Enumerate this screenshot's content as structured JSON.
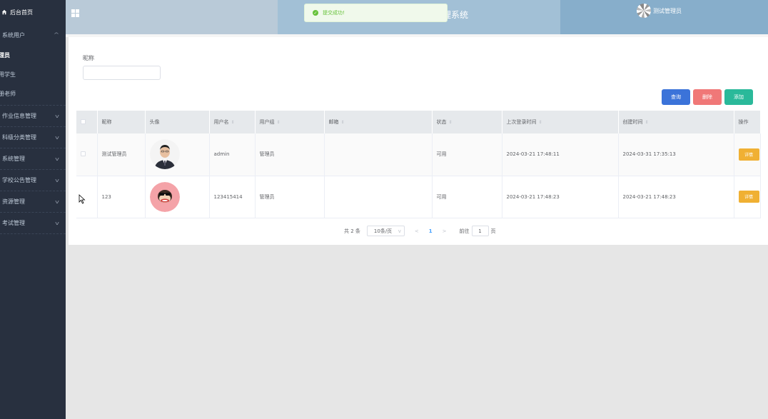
{
  "sidebar": {
    "home_label": "后台首页",
    "groups": [
      {
        "label": "系统用户",
        "expanded": true,
        "items": [
          {
            "label": "理员",
            "active": true
          },
          {
            "label": "用学生",
            "active": false
          },
          {
            "label": "册老师",
            "active": false
          }
        ]
      },
      {
        "label": "作业信息管理"
      },
      {
        "label": "科级分类管理"
      },
      {
        "label": "系统管理"
      },
      {
        "label": "学校公告管理"
      },
      {
        "label": "资源管理"
      },
      {
        "label": "考试管理"
      }
    ]
  },
  "header": {
    "title": "理系统",
    "username": "测试管理员"
  },
  "toast": {
    "message": "提交成功!",
    "color": "#67c23a"
  },
  "search": {
    "label": "昵称",
    "value": ""
  },
  "actions": {
    "query": "查询",
    "delete": "删除",
    "add": "添加"
  },
  "table": {
    "columns": [
      "昵称",
      "头像",
      "用户名",
      "用户组",
      "邮箱",
      "状态",
      "上次登录时间",
      "创建时间",
      "操作"
    ],
    "rows": [
      {
        "nickname": "测试管理员",
        "username": "admin",
        "group": "管理员",
        "email": "",
        "status": "可用",
        "last_login": "2024-03-21 17:48:11",
        "created": "2024-03-31 17:35:13",
        "action": "详情"
      },
      {
        "nickname": "123",
        "username": "123415414",
        "group": "管理员",
        "email": "",
        "status": "可用",
        "last_login": "2024-03-21 17:48:23",
        "created": "2024-03-21 17:48:23",
        "action": "详情"
      }
    ]
  },
  "pagination": {
    "total": "共 2 条",
    "page_size": "10条/页",
    "prev": "<",
    "current": "1",
    "next": ">",
    "goto_prefix": "前往",
    "goto_value": "1",
    "goto_suffix": "页"
  },
  "colors": {
    "sidebar_bg": "#28303f",
    "query": "#3b73d9",
    "delete": "#f07878",
    "add": "#2ab99a",
    "detail": "#f0b033"
  }
}
